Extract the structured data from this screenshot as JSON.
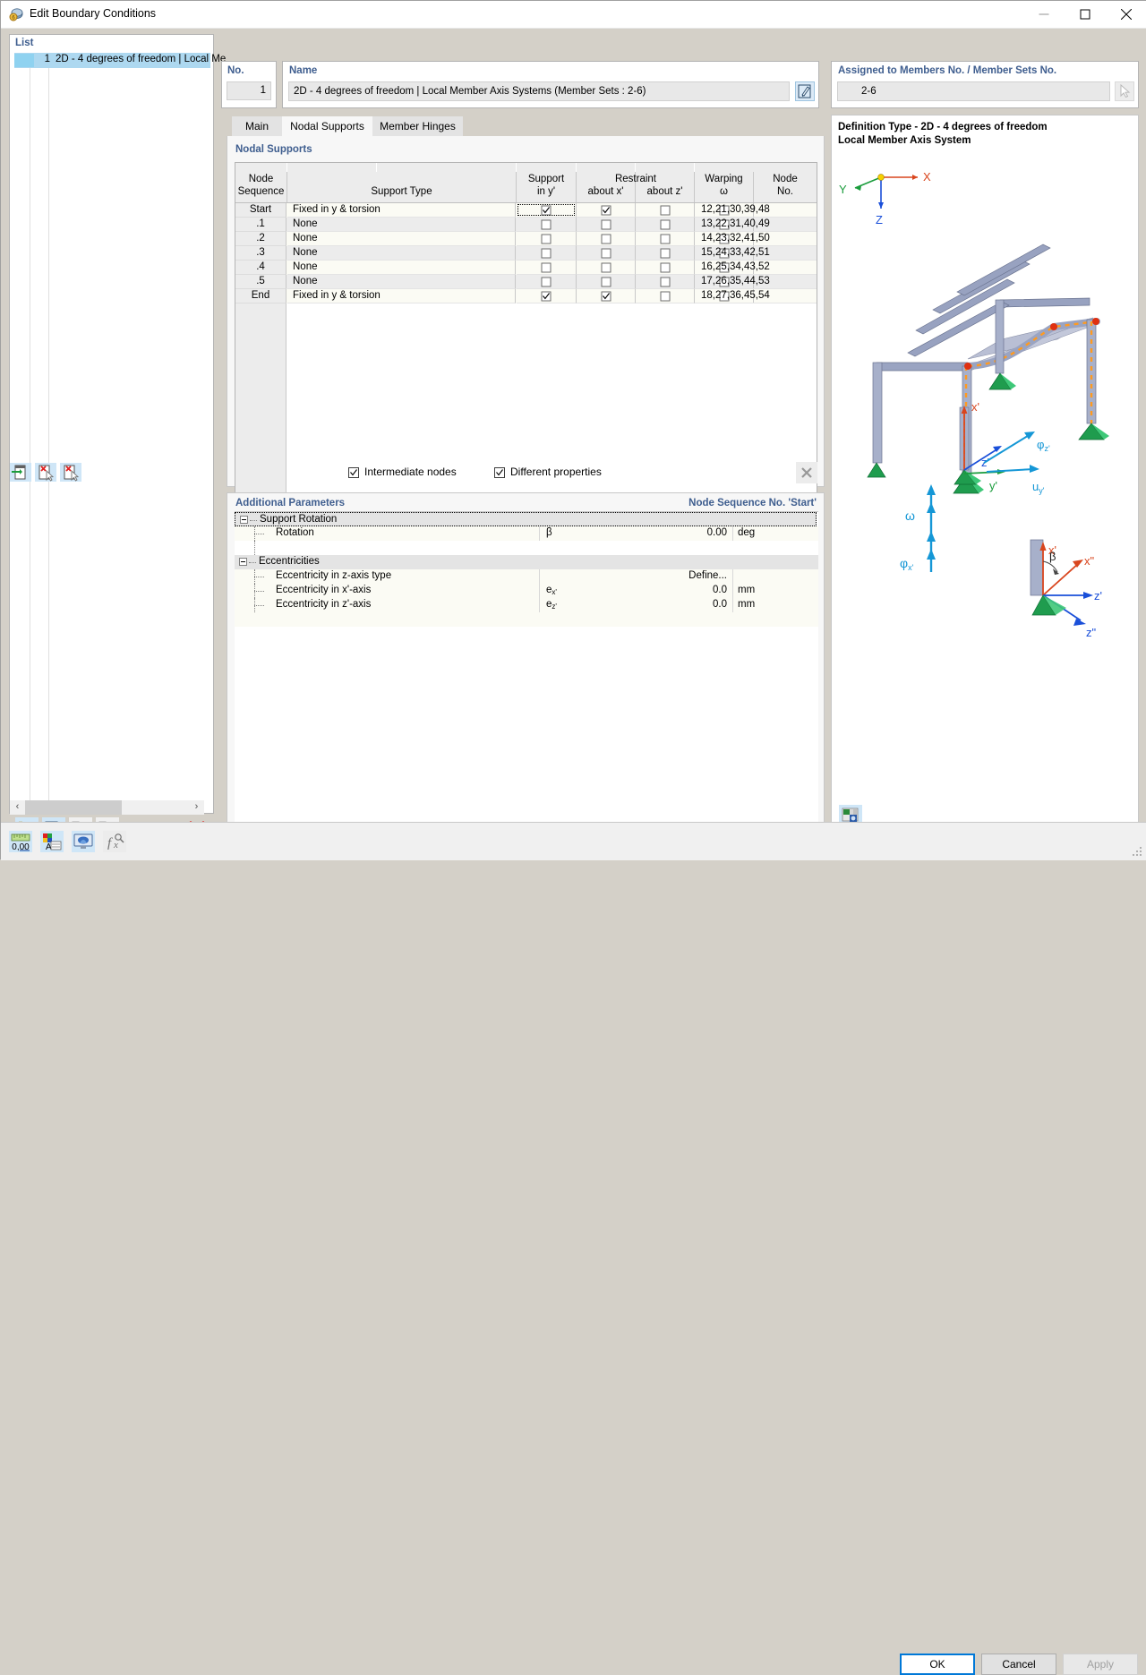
{
  "window": {
    "title": "Edit Boundary Conditions",
    "icon": "boundary-conditions-icon",
    "minimize": "minimize-icon",
    "maximize": "maximize-icon",
    "close": "close-icon"
  },
  "list": {
    "header": "List",
    "items": [
      {
        "no": "1",
        "label": "2D - 4 degrees of freedom | Local Me"
      }
    ],
    "scroll": {
      "left": "‹",
      "right": "›"
    },
    "tools": [
      {
        "name": "new-item-button",
        "icon": "new-window-icon"
      },
      {
        "name": "copy-item-button",
        "icon": "copy-window-icon"
      },
      {
        "name": "select-all-button",
        "icon": "check-all-icon"
      },
      {
        "name": "deselect-button",
        "icon": "uncheck-icon"
      },
      {
        "name": "delete-item-button",
        "icon": "red-x-icon"
      }
    ]
  },
  "no_panel": {
    "label": "No.",
    "value": "1"
  },
  "name_panel": {
    "label": "Name",
    "value": "2D - 4 degrees of freedom | Local Member Axis Systems (Member Sets : 2-6)",
    "edit_icon": "edit-pencil-icon"
  },
  "assigned_panel": {
    "label": "Assigned to Members No. / Member Sets No.",
    "value": "2-6",
    "member_icon": "member-line-icon",
    "pick_icon": "pick-cursor-icon"
  },
  "tabs": [
    {
      "label": "Main",
      "selected": false
    },
    {
      "label": "Nodal Supports",
      "selected": true
    },
    {
      "label": "Member Hinges",
      "selected": false
    }
  ],
  "nodal_supports": {
    "section_title": "Nodal Supports",
    "columns": [
      {
        "line1": "Node",
        "line2": "Sequence"
      },
      {
        "line1": "Support Type",
        "line2": ""
      },
      {
        "line1": "Support",
        "line2": "in y'"
      },
      {
        "line1": "Restraint",
        "line2": "about x'"
      },
      {
        "line1": "",
        "line2": "about z'"
      },
      {
        "line1": "Warping",
        "line2": "ω"
      },
      {
        "line1": "Node",
        "line2": "No."
      }
    ],
    "rows": [
      {
        "seq": "Start",
        "type": "Fixed in y & torsion",
        "support_y": true,
        "restraint_x": true,
        "restraint_z": false,
        "warping": false,
        "nodes": "12,21,30,39,48",
        "focused": true
      },
      {
        "seq": ".1",
        "type": "None",
        "support_y": false,
        "restraint_x": false,
        "restraint_z": false,
        "warping": false,
        "nodes": "13,22,31,40,49",
        "focused": false
      },
      {
        "seq": ".2",
        "type": "None",
        "support_y": false,
        "restraint_x": false,
        "restraint_z": false,
        "warping": false,
        "nodes": "14,23,32,41,50",
        "focused": false
      },
      {
        "seq": ".3",
        "type": "None",
        "support_y": false,
        "restraint_x": false,
        "restraint_z": false,
        "warping": false,
        "nodes": "15,24,33,42,51",
        "focused": false
      },
      {
        "seq": ".4",
        "type": "None",
        "support_y": false,
        "restraint_x": false,
        "restraint_z": false,
        "warping": false,
        "nodes": "16,25,34,43,52",
        "focused": false
      },
      {
        "seq": ".5",
        "type": "None",
        "support_y": false,
        "restraint_x": false,
        "restraint_z": false,
        "warping": false,
        "nodes": "17,26,35,44,53",
        "focused": false
      },
      {
        "seq": "End",
        "type": "Fixed in y & torsion",
        "support_y": true,
        "restraint_x": true,
        "restraint_z": false,
        "warping": false,
        "nodes": "18,27,36,45,54",
        "focused": false
      }
    ],
    "toolbar": [
      {
        "name": "insert-row-button",
        "icon": "insert-row-icon"
      },
      {
        "name": "delete-row-button",
        "icon": "delete-row-icon"
      },
      {
        "name": "delete-all-rows-button",
        "icon": "delete-all-rows-icon"
      }
    ],
    "checkboxes": [
      {
        "label": "Intermediate nodes",
        "checked": true
      },
      {
        "label": "Different properties",
        "checked": true
      }
    ],
    "close_icon": "close-x-icon"
  },
  "additional_parameters": {
    "title": "Additional Parameters",
    "node_sequence_label": "Node Sequence No. 'Start'",
    "groups": [
      {
        "name": "Support Rotation",
        "focused": true,
        "rows": [
          {
            "name": "Rotation",
            "symbol": "β",
            "value": "0.00",
            "unit": "deg"
          }
        ]
      },
      {
        "name": "Eccentricities",
        "focused": false,
        "rows": [
          {
            "name": "Eccentricity in z-axis type",
            "symbol": "",
            "value": "Define...",
            "unit": ""
          },
          {
            "name": "Eccentricity in x'-axis",
            "symbol": "e",
            "sub": "x'",
            "value": "0.0",
            "unit": "mm"
          },
          {
            "name": "Eccentricity in z'-axis",
            "symbol": "e",
            "sub": "z'",
            "value": "0.0",
            "unit": "mm"
          }
        ]
      }
    ]
  },
  "view_panel": {
    "info_line1": "Definition Type - 2D - 4 degrees of freedom",
    "info_line2": "Local Member Axis System",
    "global_axes": [
      {
        "label": "X",
        "color": "#d9461e"
      },
      {
        "label": "Y",
        "color": "#1a9c3c"
      },
      {
        "label": "Z",
        "color": "#1a4fd9"
      }
    ],
    "local_axes": [
      {
        "label": "x'",
        "color": "#d9461e"
      },
      {
        "label": "y'",
        "color": "#1a9c3c"
      },
      {
        "label": "z'",
        "color": "#1a4fd9"
      },
      {
        "label": "x\"",
        "color": "#d9461e"
      },
      {
        "label": "z\"",
        "color": "#1a4fd9"
      }
    ],
    "dof_labels": [
      {
        "label": "u",
        "sub": "y'"
      },
      {
        "label": "φ",
        "sub": "z'"
      },
      {
        "label": "φ",
        "sub": "x'"
      },
      {
        "label": "ω",
        "sub": ""
      },
      {
        "label": "β",
        "sub": ""
      }
    ],
    "snapshot_icon": "snapshot-icon"
  },
  "status_tools": [
    {
      "name": "units-button",
      "icon": "ruler-00-icon",
      "enabled": true
    },
    {
      "name": "display-properties-button",
      "icon": "color-properties-icon",
      "enabled": true
    },
    {
      "name": "render-button",
      "icon": "render-screen-icon",
      "enabled": true
    },
    {
      "name": "formula-button",
      "icon": "fx-icon",
      "enabled": false
    }
  ],
  "dialog_buttons": [
    {
      "label": "OK",
      "style": "primary"
    },
    {
      "label": "Cancel",
      "style": "normal"
    },
    {
      "label": "Apply",
      "style": "disabled"
    }
  ]
}
